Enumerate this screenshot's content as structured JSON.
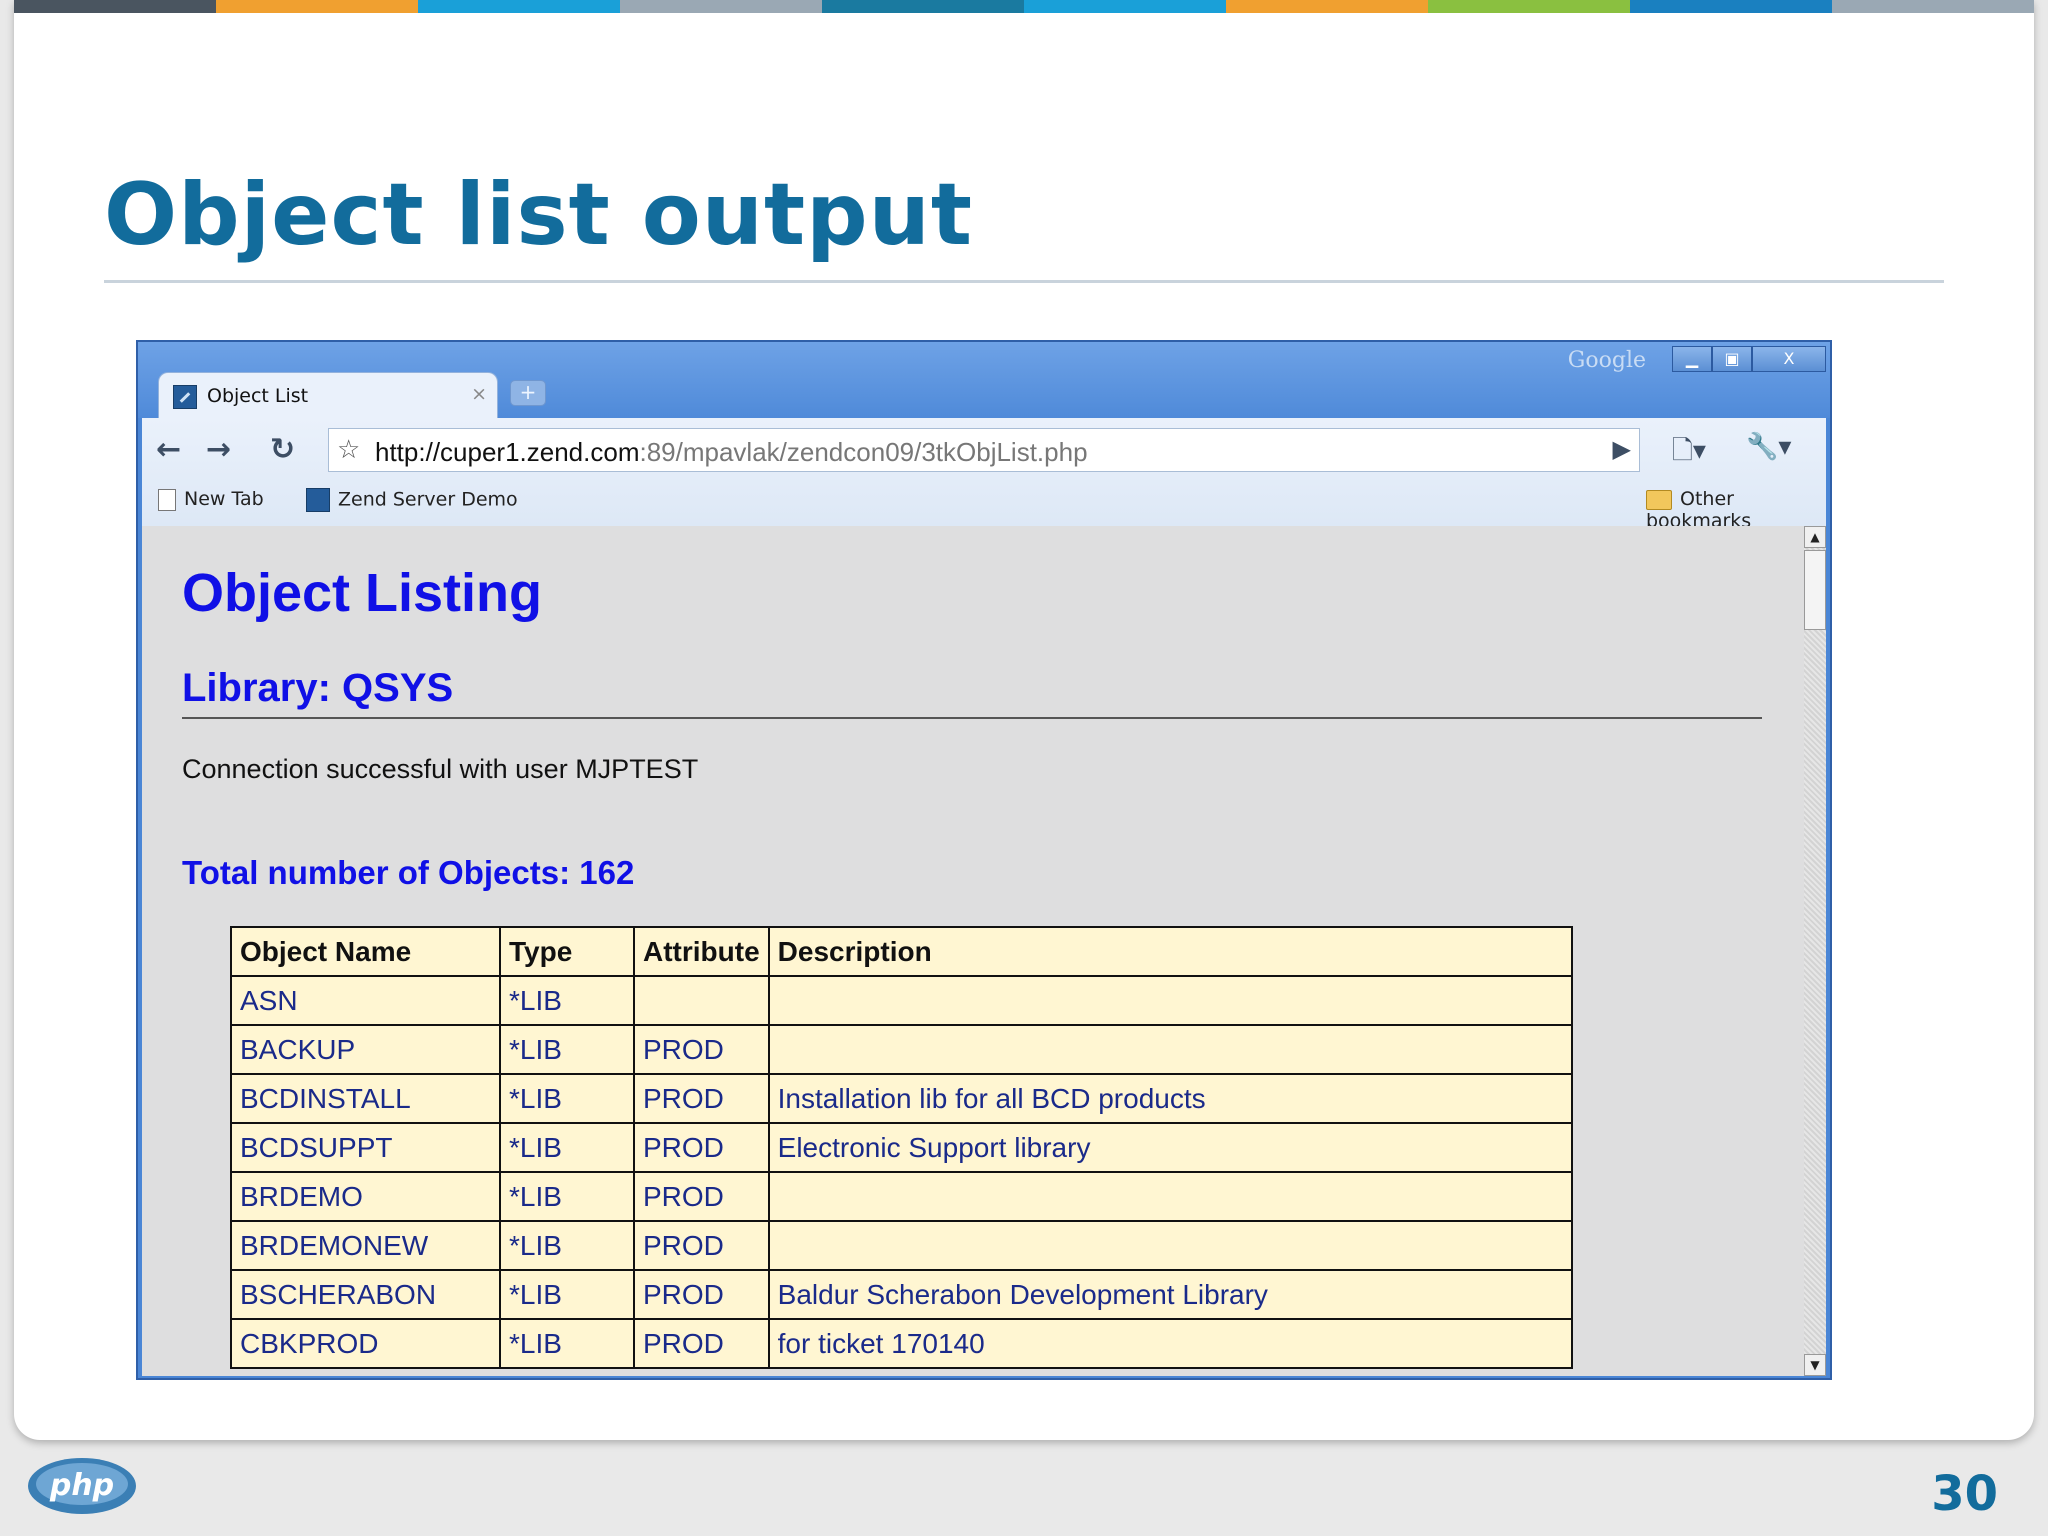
{
  "slide": {
    "title": "Object list output",
    "page_number": "30",
    "logo_text": "php",
    "colors": {
      "title": "#126c9c",
      "topbar": [
        "#4a5560",
        "#f0a030",
        "#1aa0d8",
        "#9aa8b4",
        "#1a7aa0",
        "#1aa0d8",
        "#f0a030",
        "#8ac040",
        "#1a80c0",
        "#9aa8b4"
      ]
    }
  },
  "browser": {
    "tab_title": "Object List",
    "tab_close": "×",
    "newtab_symbol": "+",
    "google_word": "Google",
    "window_buttons": [
      "▁",
      "▣",
      "X"
    ],
    "nav": {
      "back": "←",
      "forward": "→",
      "reload": "↻"
    },
    "star": "☆",
    "url_host": "http://cuper1.zend.com",
    "url_path": ":89/mpavlak/zendcon09/3tkObjList.php",
    "go": "▶",
    "page_menu": "🗋▾",
    "tools_menu": "🔧▾",
    "bookmarks": [
      {
        "label": "New Tab",
        "icon": "page-icon"
      },
      {
        "label": "Zend Server Demo",
        "icon": "zend-icon"
      }
    ],
    "other_bookmarks": "Other bookmarks"
  },
  "page": {
    "heading": "Object Listing",
    "library": "Library: QSYS",
    "connection": "Connection successful with user MJPTEST",
    "total": "Total number of Objects: 162",
    "columns": [
      "Object Name",
      "Type",
      "Attribute",
      "Description"
    ],
    "rows": [
      [
        "ASN",
        "*LIB",
        "",
        ""
      ],
      [
        "BACKUP",
        "*LIB",
        "PROD",
        ""
      ],
      [
        "BCDINSTALL",
        "*LIB",
        "PROD",
        "Installation lib for all BCD products"
      ],
      [
        "BCDSUPPT",
        "*LIB",
        "PROD",
        "Electronic Support library"
      ],
      [
        "BRDEMO",
        "*LIB",
        "PROD",
        ""
      ],
      [
        "BRDEMONEW",
        "*LIB",
        "PROD",
        ""
      ],
      [
        "BSCHERABON",
        "*LIB",
        "PROD",
        "Baldur Scherabon Development Library"
      ],
      [
        "CBKPROD",
        "*LIB",
        "PROD",
        "for ticket 170140"
      ]
    ]
  }
}
